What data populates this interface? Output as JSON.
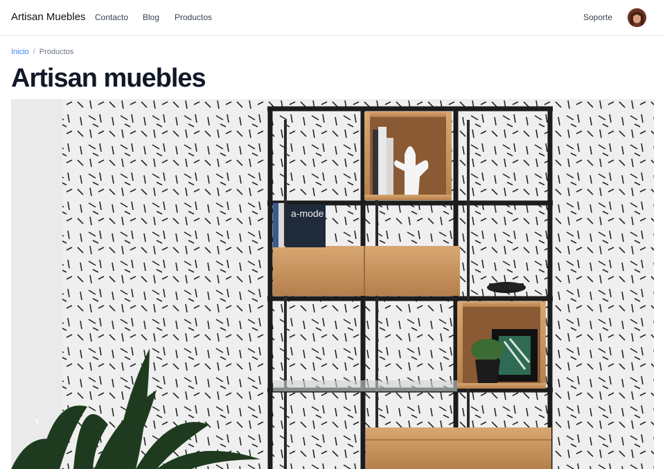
{
  "header": {
    "brand": "Artisan Muebles",
    "nav": [
      "Contacto",
      "Blog",
      "Productos"
    ],
    "support": "Soporte"
  },
  "breadcrumb": {
    "home": "Inicio",
    "current": "Productos"
  },
  "page": {
    "title": "Artisan muebles"
  },
  "carousel": {
    "prev_icon": "chevron-left-icon",
    "next_icon": "chevron-right-icon",
    "magazine_text": "a-mode"
  },
  "colors": {
    "link": "#3b82f6",
    "title": "#111827",
    "frame": "#1f1f1f",
    "wood": "#c9955c"
  }
}
